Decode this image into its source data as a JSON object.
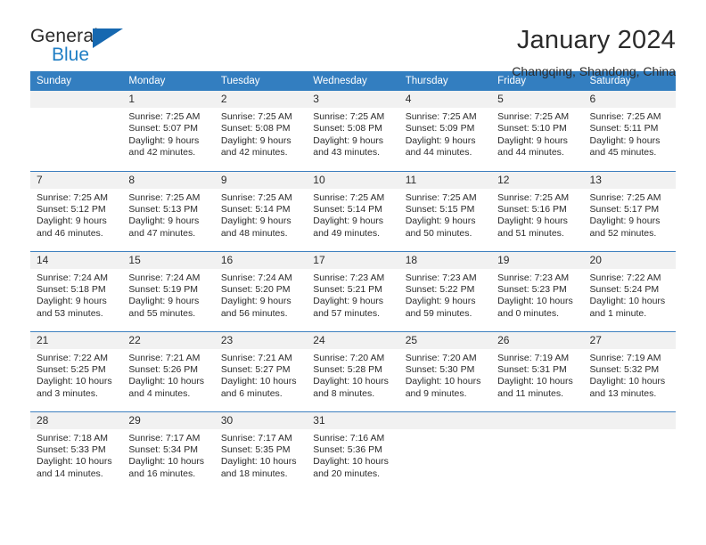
{
  "brand": {
    "name_top": "General",
    "name_bottom": "Blue",
    "accent_color": "#1668b0",
    "text_color": "#2b2b2b"
  },
  "header": {
    "title": "January 2024",
    "subtitle": "Changqing, Shandong, China"
  },
  "theme": {
    "header_bar_color": "#337ec0",
    "daynum_band_color": "#f1f1f1",
    "row_divider_color": "#3d7fbf"
  },
  "weekday_headers": [
    "Sunday",
    "Monday",
    "Tuesday",
    "Wednesday",
    "Thursday",
    "Friday",
    "Saturday"
  ],
  "weeks": [
    [
      {
        "day": "",
        "sunrise": "",
        "sunset": "",
        "daylight_line1": "",
        "daylight_line2": ""
      },
      {
        "day": "1",
        "sunrise": "Sunrise: 7:25 AM",
        "sunset": "Sunset: 5:07 PM",
        "daylight_line1": "Daylight: 9 hours",
        "daylight_line2": "and 42 minutes."
      },
      {
        "day": "2",
        "sunrise": "Sunrise: 7:25 AM",
        "sunset": "Sunset: 5:08 PM",
        "daylight_line1": "Daylight: 9 hours",
        "daylight_line2": "and 42 minutes."
      },
      {
        "day": "3",
        "sunrise": "Sunrise: 7:25 AM",
        "sunset": "Sunset: 5:08 PM",
        "daylight_line1": "Daylight: 9 hours",
        "daylight_line2": "and 43 minutes."
      },
      {
        "day": "4",
        "sunrise": "Sunrise: 7:25 AM",
        "sunset": "Sunset: 5:09 PM",
        "daylight_line1": "Daylight: 9 hours",
        "daylight_line2": "and 44 minutes."
      },
      {
        "day": "5",
        "sunrise": "Sunrise: 7:25 AM",
        "sunset": "Sunset: 5:10 PM",
        "daylight_line1": "Daylight: 9 hours",
        "daylight_line2": "and 44 minutes."
      },
      {
        "day": "6",
        "sunrise": "Sunrise: 7:25 AM",
        "sunset": "Sunset: 5:11 PM",
        "daylight_line1": "Daylight: 9 hours",
        "daylight_line2": "and 45 minutes."
      }
    ],
    [
      {
        "day": "7",
        "sunrise": "Sunrise: 7:25 AM",
        "sunset": "Sunset: 5:12 PM",
        "daylight_line1": "Daylight: 9 hours",
        "daylight_line2": "and 46 minutes."
      },
      {
        "day": "8",
        "sunrise": "Sunrise: 7:25 AM",
        "sunset": "Sunset: 5:13 PM",
        "daylight_line1": "Daylight: 9 hours",
        "daylight_line2": "and 47 minutes."
      },
      {
        "day": "9",
        "sunrise": "Sunrise: 7:25 AM",
        "sunset": "Sunset: 5:14 PM",
        "daylight_line1": "Daylight: 9 hours",
        "daylight_line2": "and 48 minutes."
      },
      {
        "day": "10",
        "sunrise": "Sunrise: 7:25 AM",
        "sunset": "Sunset: 5:14 PM",
        "daylight_line1": "Daylight: 9 hours",
        "daylight_line2": "and 49 minutes."
      },
      {
        "day": "11",
        "sunrise": "Sunrise: 7:25 AM",
        "sunset": "Sunset: 5:15 PM",
        "daylight_line1": "Daylight: 9 hours",
        "daylight_line2": "and 50 minutes."
      },
      {
        "day": "12",
        "sunrise": "Sunrise: 7:25 AM",
        "sunset": "Sunset: 5:16 PM",
        "daylight_line1": "Daylight: 9 hours",
        "daylight_line2": "and 51 minutes."
      },
      {
        "day": "13",
        "sunrise": "Sunrise: 7:25 AM",
        "sunset": "Sunset: 5:17 PM",
        "daylight_line1": "Daylight: 9 hours",
        "daylight_line2": "and 52 minutes."
      }
    ],
    [
      {
        "day": "14",
        "sunrise": "Sunrise: 7:24 AM",
        "sunset": "Sunset: 5:18 PM",
        "daylight_line1": "Daylight: 9 hours",
        "daylight_line2": "and 53 minutes."
      },
      {
        "day": "15",
        "sunrise": "Sunrise: 7:24 AM",
        "sunset": "Sunset: 5:19 PM",
        "daylight_line1": "Daylight: 9 hours",
        "daylight_line2": "and 55 minutes."
      },
      {
        "day": "16",
        "sunrise": "Sunrise: 7:24 AM",
        "sunset": "Sunset: 5:20 PM",
        "daylight_line1": "Daylight: 9 hours",
        "daylight_line2": "and 56 minutes."
      },
      {
        "day": "17",
        "sunrise": "Sunrise: 7:23 AM",
        "sunset": "Sunset: 5:21 PM",
        "daylight_line1": "Daylight: 9 hours",
        "daylight_line2": "and 57 minutes."
      },
      {
        "day": "18",
        "sunrise": "Sunrise: 7:23 AM",
        "sunset": "Sunset: 5:22 PM",
        "daylight_line1": "Daylight: 9 hours",
        "daylight_line2": "and 59 minutes."
      },
      {
        "day": "19",
        "sunrise": "Sunrise: 7:23 AM",
        "sunset": "Sunset: 5:23 PM",
        "daylight_line1": "Daylight: 10 hours",
        "daylight_line2": "and 0 minutes."
      },
      {
        "day": "20",
        "sunrise": "Sunrise: 7:22 AM",
        "sunset": "Sunset: 5:24 PM",
        "daylight_line1": "Daylight: 10 hours",
        "daylight_line2": "and 1 minute."
      }
    ],
    [
      {
        "day": "21",
        "sunrise": "Sunrise: 7:22 AM",
        "sunset": "Sunset: 5:25 PM",
        "daylight_line1": "Daylight: 10 hours",
        "daylight_line2": "and 3 minutes."
      },
      {
        "day": "22",
        "sunrise": "Sunrise: 7:21 AM",
        "sunset": "Sunset: 5:26 PM",
        "daylight_line1": "Daylight: 10 hours",
        "daylight_line2": "and 4 minutes."
      },
      {
        "day": "23",
        "sunrise": "Sunrise: 7:21 AM",
        "sunset": "Sunset: 5:27 PM",
        "daylight_line1": "Daylight: 10 hours",
        "daylight_line2": "and 6 minutes."
      },
      {
        "day": "24",
        "sunrise": "Sunrise: 7:20 AM",
        "sunset": "Sunset: 5:28 PM",
        "daylight_line1": "Daylight: 10 hours",
        "daylight_line2": "and 8 minutes."
      },
      {
        "day": "25",
        "sunrise": "Sunrise: 7:20 AM",
        "sunset": "Sunset: 5:30 PM",
        "daylight_line1": "Daylight: 10 hours",
        "daylight_line2": "and 9 minutes."
      },
      {
        "day": "26",
        "sunrise": "Sunrise: 7:19 AM",
        "sunset": "Sunset: 5:31 PM",
        "daylight_line1": "Daylight: 10 hours",
        "daylight_line2": "and 11 minutes."
      },
      {
        "day": "27",
        "sunrise": "Sunrise: 7:19 AM",
        "sunset": "Sunset: 5:32 PM",
        "daylight_line1": "Daylight: 10 hours",
        "daylight_line2": "and 13 minutes."
      }
    ],
    [
      {
        "day": "28",
        "sunrise": "Sunrise: 7:18 AM",
        "sunset": "Sunset: 5:33 PM",
        "daylight_line1": "Daylight: 10 hours",
        "daylight_line2": "and 14 minutes."
      },
      {
        "day": "29",
        "sunrise": "Sunrise: 7:17 AM",
        "sunset": "Sunset: 5:34 PM",
        "daylight_line1": "Daylight: 10 hours",
        "daylight_line2": "and 16 minutes."
      },
      {
        "day": "30",
        "sunrise": "Sunrise: 7:17 AM",
        "sunset": "Sunset: 5:35 PM",
        "daylight_line1": "Daylight: 10 hours",
        "daylight_line2": "and 18 minutes."
      },
      {
        "day": "31",
        "sunrise": "Sunrise: 7:16 AM",
        "sunset": "Sunset: 5:36 PM",
        "daylight_line1": "Daylight: 10 hours",
        "daylight_line2": "and 20 minutes."
      },
      {
        "day": "",
        "sunrise": "",
        "sunset": "",
        "daylight_line1": "",
        "daylight_line2": ""
      },
      {
        "day": "",
        "sunrise": "",
        "sunset": "",
        "daylight_line1": "",
        "daylight_line2": ""
      },
      {
        "day": "",
        "sunrise": "",
        "sunset": "",
        "daylight_line1": "",
        "daylight_line2": ""
      }
    ]
  ]
}
